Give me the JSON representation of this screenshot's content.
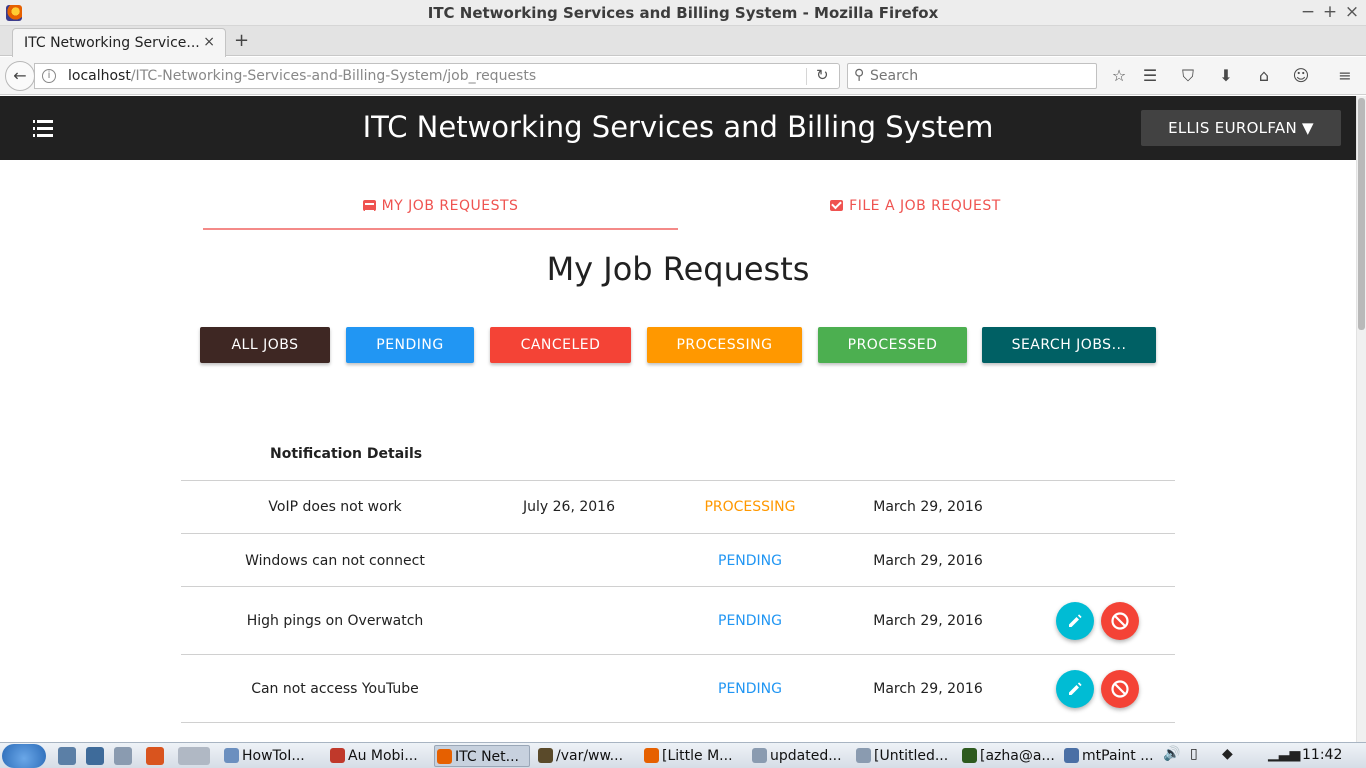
{
  "window": {
    "title": "ITC Networking Services and Billing System - Mozilla Firefox",
    "minimize": "−",
    "maximize": "+",
    "close": "×"
  },
  "browser": {
    "tab_label": "ITC Networking Service...",
    "tab_close": "×",
    "new_tab": "+",
    "url_host": "localhost",
    "url_path": "/ITC-Networking-Services-and-Billing-System/job_requests",
    "search_placeholder": "Search"
  },
  "app": {
    "title": "ITC Networking Services and Billing System",
    "user_button": "ELLIS EUROLFAN ▼"
  },
  "tabs": [
    {
      "label": "MY JOB REQUESTS",
      "icon": "chat-icon",
      "active": true
    },
    {
      "label": "FILE A JOB REQUEST",
      "icon": "mail-icon",
      "active": false
    }
  ],
  "page_title": "My Job Requests",
  "filters": [
    {
      "label": "ALL JOBS",
      "color": "#3e2723",
      "text_color": "#ffffff"
    },
    {
      "label": "PENDING",
      "color": "#2196f3",
      "text_color": "#ffffff"
    },
    {
      "label": "CANCELED",
      "color": "#f44336",
      "text_color": "#ffffff"
    },
    {
      "label": "PROCESSING",
      "color": "#ff9800",
      "text_color": "#ffffff"
    },
    {
      "label": "PROCESSED",
      "color": "#4caf50",
      "text_color": "#ffffff"
    },
    {
      "label": "SEARCH JOBS...",
      "color": "#006064",
      "text_color": "#ffffff"
    }
  ],
  "table": {
    "header": "Notification Details",
    "rows": [
      {
        "title": "VoIP does not work",
        "date": "July 26, 2016",
        "status": "PROCESSING",
        "filed": "March 29, 2016",
        "actions": false
      },
      {
        "title": "Windows can not connect",
        "date": "",
        "status": "PENDING",
        "filed": "March 29, 2016",
        "actions": false
      },
      {
        "title": "High pings on Overwatch",
        "date": "",
        "status": "PENDING",
        "filed": "March 29, 2016",
        "actions": true
      },
      {
        "title": "Can not access YouTube",
        "date": "",
        "status": "PENDING",
        "filed": "March 29, 2016",
        "actions": true
      }
    ]
  },
  "taskbar": {
    "tasks": [
      "HowToI...",
      "Au Mobi...",
      "ITC Net...",
      "/var/ww...",
      "[Little M...",
      "updated...",
      "[Untitled...",
      "[azha@a...",
      "mtPaint ..."
    ],
    "clock": "11:42"
  }
}
